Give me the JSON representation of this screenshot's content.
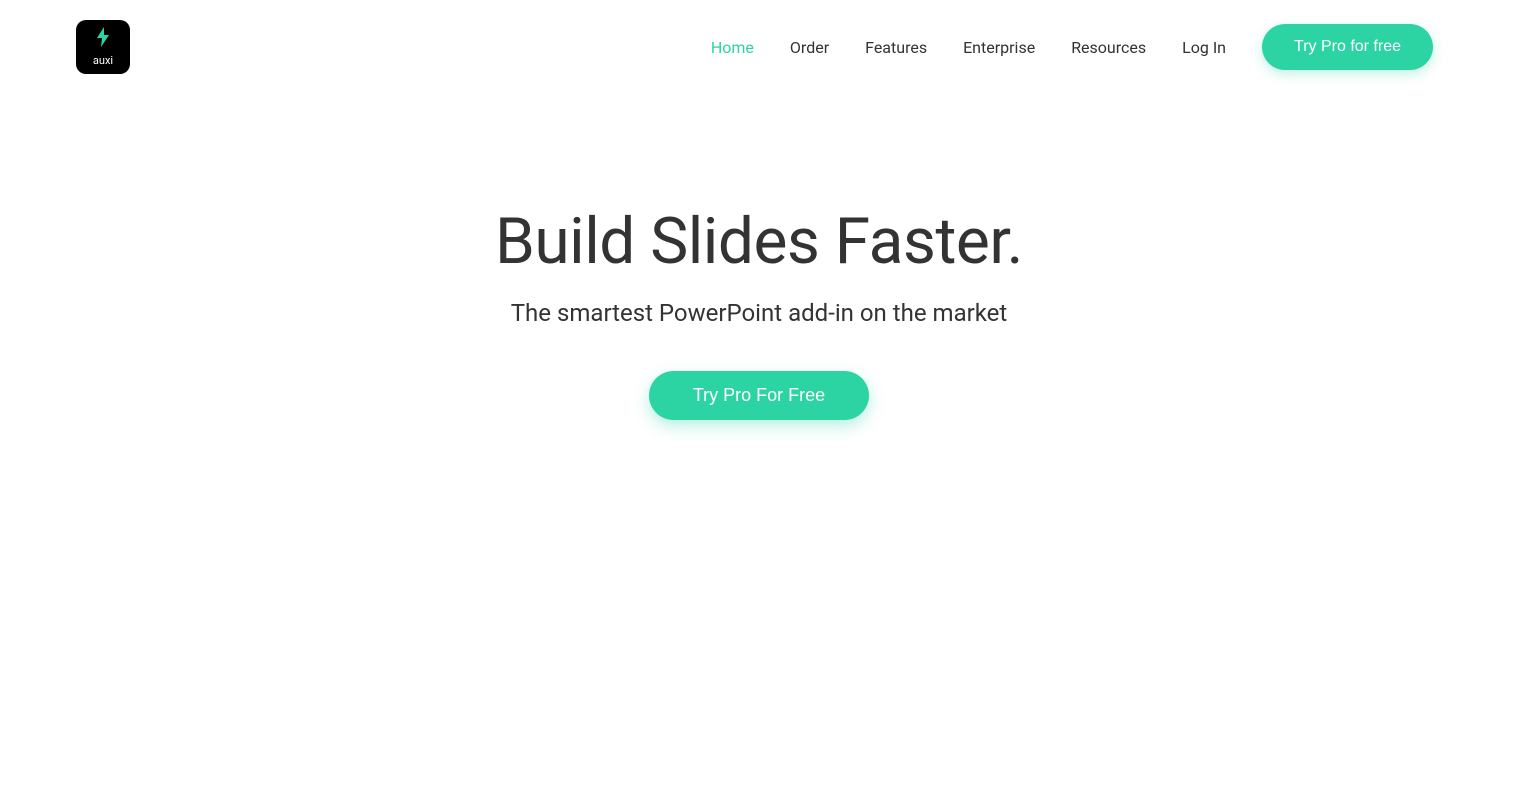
{
  "logo": {
    "name": "auxi"
  },
  "nav": {
    "items": [
      {
        "label": "Home",
        "active": true
      },
      {
        "label": "Order",
        "active": false
      },
      {
        "label": "Features",
        "active": false
      },
      {
        "label": "Enterprise",
        "active": false
      },
      {
        "label": "Resources",
        "active": false
      },
      {
        "label": "Log In",
        "active": false
      }
    ],
    "cta_label": "Try Pro for free"
  },
  "hero": {
    "title": "Build Slides Faster.",
    "subtitle": "The smartest PowerPoint add-in on the market",
    "cta_label": "Try Pro For Free"
  }
}
